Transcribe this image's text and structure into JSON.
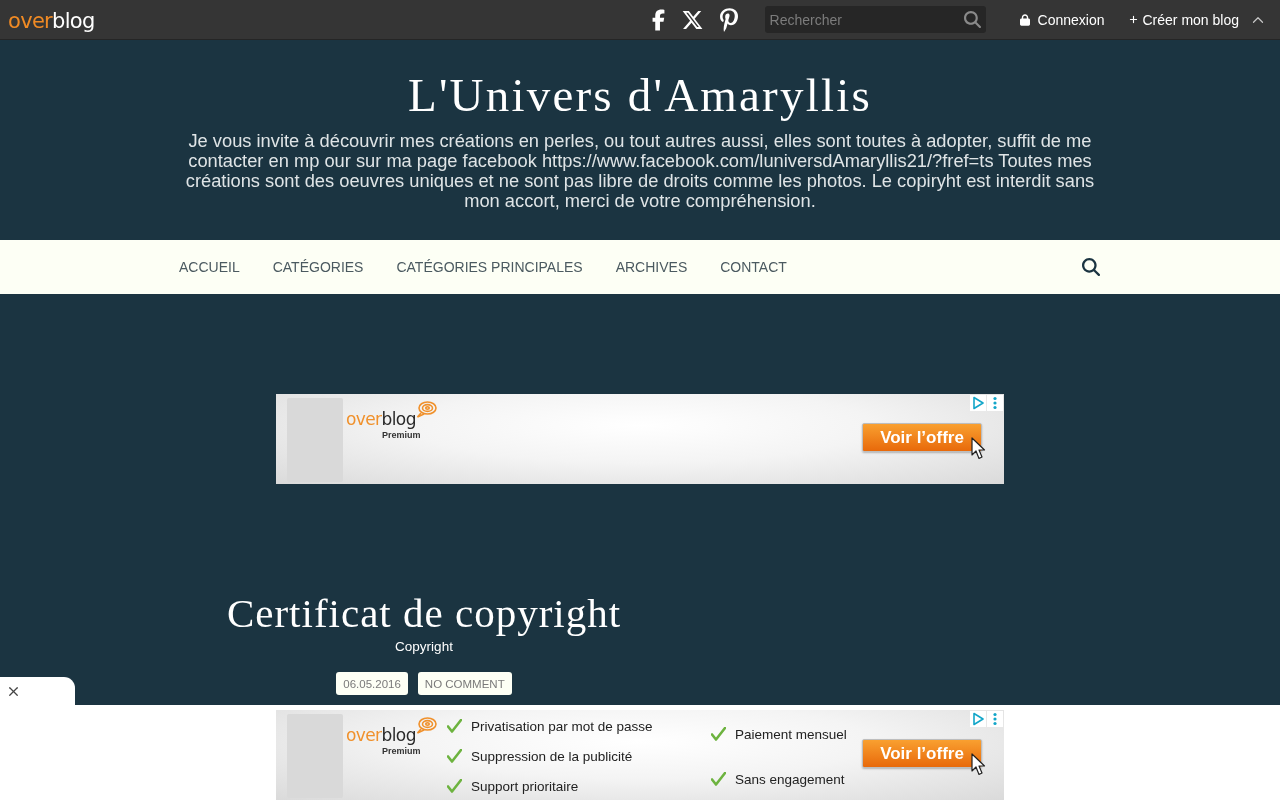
{
  "top_bar": {
    "logo": [
      "over",
      "blog"
    ],
    "search": {
      "placeholder": "Rechercher"
    },
    "login": "Connexion",
    "create_blog": "Créer mon blog"
  },
  "header": {
    "title": "L'Univers d'Amaryllis",
    "description": "Je vous invite à découvrir mes créations en perles, ou tout autres aussi, elles sont toutes à adopter, suffit de me contacter en mp our sur ma page facebook https://www.facebook.com/luniversdAmaryllis21/?fref=ts Toutes mes créations sont des oeuvres uniques et ne sont pas libre de droits comme les photos. Le copiryht est interdit sans mon accort, merci de votre compréhension."
  },
  "nav": {
    "items": [
      "ACCUEIL",
      "CATÉGORIES",
      "CATÉGORIES PRINCIPALES",
      "ARCHIVES",
      "CONTACT"
    ]
  },
  "ad": {
    "logo": [
      "over",
      "blog"
    ],
    "logo_caption": "Premium",
    "button": "Voir l’offre"
  },
  "article": {
    "title": "Certificat de copyright",
    "category": "Copyright",
    "date": "06.05.2016",
    "comments": "NO COMMENT"
  },
  "footer_ad": {
    "logo": [
      "over",
      "blog"
    ],
    "logo_caption": "Premium",
    "feature_columns": [
      [
        "Privatisation par mot de passe",
        "Suppression de la publicité",
        "Support prioritaire"
      ],
      [
        "Paiement mensuel",
        "Sans engagement"
      ]
    ],
    "button": "Voir l’offre"
  }
}
